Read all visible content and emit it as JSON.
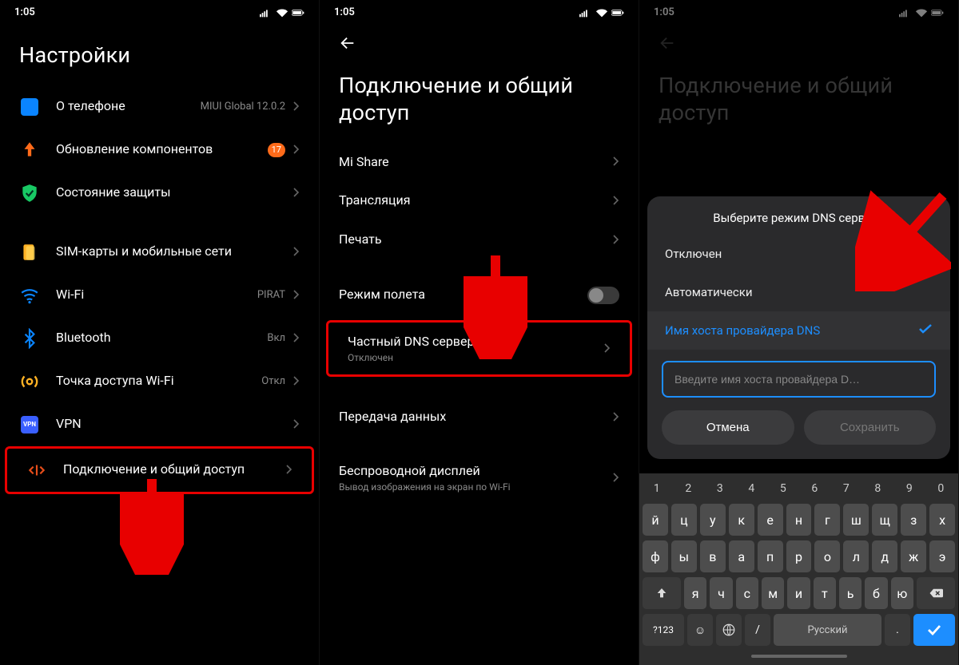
{
  "status_time": "1:05",
  "screen1": {
    "title": "Настройки",
    "items": [
      {
        "key": "about",
        "label": "О телефоне",
        "value": "MIUI Global 12.0.2"
      },
      {
        "key": "update",
        "label": "Обновление компонентов",
        "badge": "17"
      },
      {
        "key": "security",
        "label": "Состояние защиты"
      },
      {
        "key": "sim",
        "label": "SIM-карты и мобильные сети"
      },
      {
        "key": "wifi",
        "label": "Wi-Fi",
        "value": "PIRAT"
      },
      {
        "key": "bluetooth",
        "label": "Bluetooth",
        "value": "Вкл"
      },
      {
        "key": "hotspot",
        "label": "Точка доступа Wi-Fi",
        "value": "Откл"
      },
      {
        "key": "vpn",
        "label": "VPN"
      },
      {
        "key": "connection",
        "label": "Подключение и общий доступ"
      }
    ]
  },
  "screen2": {
    "title": "Подключение и общий доступ",
    "items": [
      {
        "key": "mishare",
        "label": "Mi Share"
      },
      {
        "key": "cast",
        "label": "Трансляция"
      },
      {
        "key": "print",
        "label": "Печать"
      },
      {
        "key": "airplane",
        "label": "Режим полета",
        "toggle": true
      },
      {
        "key": "dns",
        "label": "Частный DNS сервер",
        "sub": "Отключен"
      },
      {
        "key": "data",
        "label": "Передача данных"
      },
      {
        "key": "wdisplay",
        "label": "Беспроводной дисплей",
        "sub": "Вывод изображения на экран по Wi-Fi"
      }
    ]
  },
  "screen3": {
    "title": "Подключение и общий доступ",
    "dialog": {
      "title": "Выберите режим DNS сервера",
      "options": [
        {
          "label": "Отключен"
        },
        {
          "label": "Автоматически"
        },
        {
          "label": "Имя хоста провайдера DNS",
          "selected": true
        }
      ],
      "placeholder": "Введите имя хоста провайдера D…",
      "cancel": "Отмена",
      "save": "Сохранить"
    },
    "keyboard": {
      "nums": [
        "1",
        "2",
        "3",
        "4",
        "5",
        "6",
        "7",
        "8",
        "9",
        "0"
      ],
      "r1": [
        "й",
        "ц",
        "у",
        "к",
        "е",
        "н",
        "г",
        "ш",
        "щ",
        "з",
        "х"
      ],
      "r2": [
        "ф",
        "ы",
        "в",
        "а",
        "п",
        "р",
        "о",
        "л",
        "д",
        "ж",
        "э"
      ],
      "r3": [
        "я",
        "ч",
        "с",
        "м",
        "и",
        "т",
        "ь",
        "б",
        "ю"
      ],
      "sym": "?123",
      "space": "Русский"
    }
  }
}
